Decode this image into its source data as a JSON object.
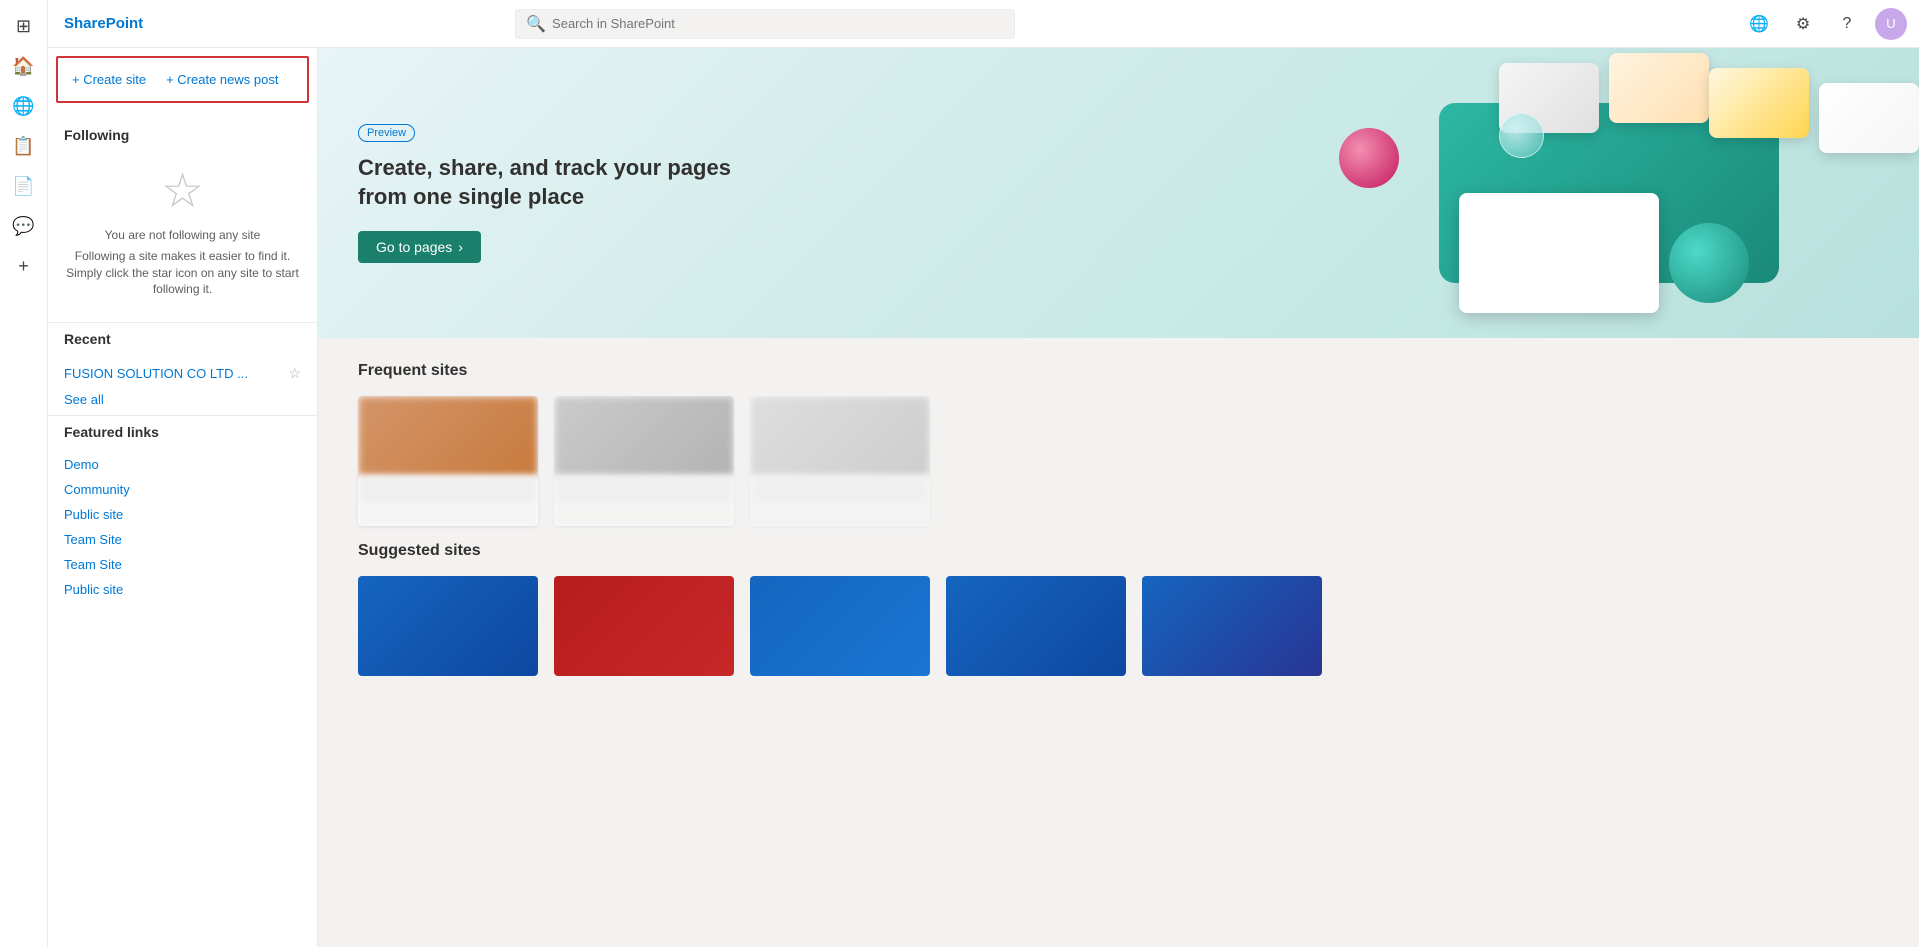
{
  "app": {
    "title": "SharePoint"
  },
  "search": {
    "placeholder": "Search in SharePoint"
  },
  "topbar": {
    "network_icon": "🌐",
    "settings_icon": "⚙",
    "help_icon": "?"
  },
  "rail_icons": [
    "⊞",
    "🏠",
    "🌐",
    "📋",
    "📄",
    "💬",
    "+"
  ],
  "actions": {
    "create_site": "+ Create site",
    "create_news": "+ Create news post"
  },
  "sidebar": {
    "following_title": "Following",
    "following_empty_main": "You are not following any site",
    "following_empty_detail": "Following a site makes it easier to find it. Simply click the star icon on any site to start following it.",
    "recent_title": "Recent",
    "recent_items": [
      {
        "text": "FUSION SOLUTION CO LTD ..."
      }
    ],
    "see_all": "See all",
    "featured_links_title": "Featured links",
    "featured_links": [
      {
        "text": "Demo"
      },
      {
        "text": "Community"
      },
      {
        "text": "Public site"
      },
      {
        "text": "Team Site"
      },
      {
        "text": "Team Site"
      },
      {
        "text": "Public site"
      }
    ]
  },
  "hero": {
    "preview_badge": "Preview",
    "title": "Create, share, and track your pages from one single place",
    "button_label": "Go to pages",
    "button_arrow": "›"
  },
  "frequent_sites": {
    "heading": "Frequent sites"
  },
  "suggested_sites": {
    "heading": "Suggested sites"
  }
}
